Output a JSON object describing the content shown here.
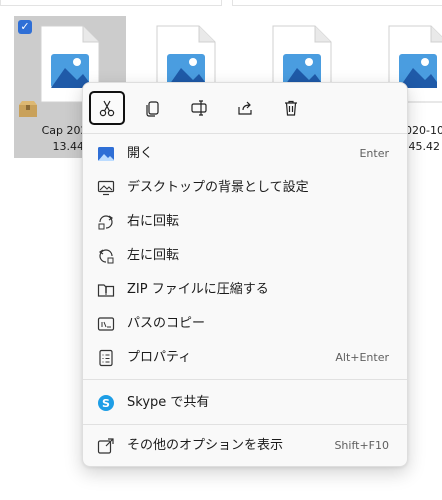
{
  "files": [
    {
      "name_line1": "Cap 2020-",
      "name_line2": "13.44."
    },
    {
      "name_line1": "",
      "name_line2": ""
    },
    {
      "name_line1": "",
      "name_line2": ""
    },
    {
      "name_line1": "2020-10",
      "name_line2": "3.45.42"
    }
  ],
  "menu": {
    "toolbar": [
      {
        "action": "cut",
        "icon": "scissors-icon"
      },
      {
        "action": "copy",
        "icon": "copy-icon"
      },
      {
        "action": "rename",
        "icon": "rename-icon"
      },
      {
        "action": "share",
        "icon": "share-icon"
      },
      {
        "action": "delete",
        "icon": "trash-icon"
      }
    ],
    "items": [
      {
        "label": "開く",
        "accel": "Enter",
        "icon": "image-file-icon"
      },
      {
        "label": "デスクトップの背景として設定",
        "accel": "",
        "icon": "desktop-background-icon"
      },
      {
        "label": "右に回転",
        "accel": "",
        "icon": "rotate-right-icon"
      },
      {
        "label": "左に回転",
        "accel": "",
        "icon": "rotate-left-icon"
      },
      {
        "label": "ZIP ファイルに圧縮する",
        "accel": "",
        "icon": "zip-folder-icon"
      },
      {
        "label": "パスのコピー",
        "accel": "",
        "icon": "copy-path-icon"
      },
      {
        "label": "プロパティ",
        "accel": "Alt+Enter",
        "icon": "properties-icon"
      },
      {
        "label": "Skype で共有",
        "accel": "",
        "icon": "skype-icon"
      },
      {
        "label": "その他のオプションを表示",
        "accel": "Shift+F10",
        "icon": "more-options-icon"
      }
    ]
  },
  "colors": {
    "accent": "#2f6fd6",
    "selection": "#cccccc",
    "menu_bg": "#f9f9f9"
  }
}
